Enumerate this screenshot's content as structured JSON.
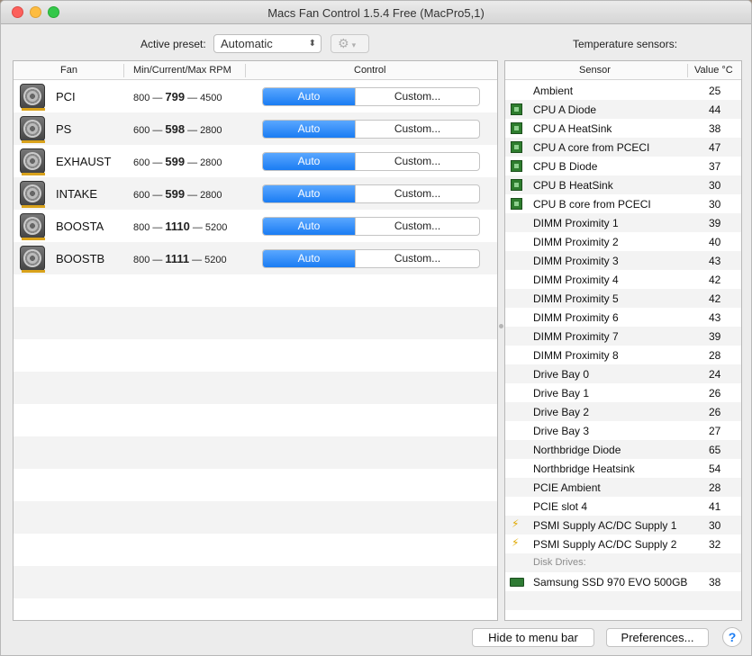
{
  "window": {
    "title": "Macs Fan Control 1.5.4 Free (MacPro5,1)"
  },
  "toolbar": {
    "active_preset_label": "Active preset:",
    "preset_value": "Automatic",
    "temperature_sensors_label": "Temperature sensors:"
  },
  "fan_table": {
    "headers": {
      "fan": "Fan",
      "rpm": "Min/Current/Max RPM",
      "control": "Control"
    },
    "rows": [
      {
        "name": "PCI",
        "min": "800",
        "current": "799",
        "max": "4500",
        "auto": "Auto",
        "custom": "Custom..."
      },
      {
        "name": "PS",
        "min": "600",
        "current": "598",
        "max": "2800",
        "auto": "Auto",
        "custom": "Custom..."
      },
      {
        "name": "EXHAUST",
        "min": "600",
        "current": "599",
        "max": "2800",
        "auto": "Auto",
        "custom": "Custom..."
      },
      {
        "name": "INTAKE",
        "min": "600",
        "current": "599",
        "max": "2800",
        "auto": "Auto",
        "custom": "Custom..."
      },
      {
        "name": "BOOSTA",
        "min": "800",
        "current": "1110",
        "max": "5200",
        "auto": "Auto",
        "custom": "Custom..."
      },
      {
        "name": "BOOSTB",
        "min": "800",
        "current": "1111",
        "max": "5200",
        "auto": "Auto",
        "custom": "Custom..."
      }
    ]
  },
  "sensor_table": {
    "headers": {
      "sensor": "Sensor",
      "value": "Value °C"
    },
    "rows": [
      {
        "name": "Ambient",
        "value": "25",
        "icon": "none"
      },
      {
        "name": "CPU A Diode",
        "value": "44",
        "icon": "chip"
      },
      {
        "name": "CPU A HeatSink",
        "value": "38",
        "icon": "chip"
      },
      {
        "name": "CPU A core from PCECI",
        "value": "47",
        "icon": "chip"
      },
      {
        "name": "CPU B Diode",
        "value": "37",
        "icon": "chip"
      },
      {
        "name": "CPU B HeatSink",
        "value": "30",
        "icon": "chip"
      },
      {
        "name": "CPU B core from PCECI",
        "value": "30",
        "icon": "chip"
      },
      {
        "name": "DIMM Proximity 1",
        "value": "39",
        "icon": "none"
      },
      {
        "name": "DIMM Proximity 2",
        "value": "40",
        "icon": "none"
      },
      {
        "name": "DIMM Proximity 3",
        "value": "43",
        "icon": "none"
      },
      {
        "name": "DIMM Proximity 4",
        "value": "42",
        "icon": "none"
      },
      {
        "name": "DIMM Proximity 5",
        "value": "42",
        "icon": "none"
      },
      {
        "name": "DIMM Proximity 6",
        "value": "43",
        "icon": "none"
      },
      {
        "name": "DIMM Proximity 7",
        "value": "39",
        "icon": "none"
      },
      {
        "name": "DIMM Proximity 8",
        "value": "28",
        "icon": "none"
      },
      {
        "name": "Drive Bay 0",
        "value": "24",
        "icon": "none"
      },
      {
        "name": "Drive Bay 1",
        "value": "26",
        "icon": "none"
      },
      {
        "name": "Drive Bay 2",
        "value": "26",
        "icon": "none"
      },
      {
        "name": "Drive Bay 3",
        "value": "27",
        "icon": "none"
      },
      {
        "name": "Northbridge Diode",
        "value": "65",
        "icon": "none"
      },
      {
        "name": "Northbridge Heatsink",
        "value": "54",
        "icon": "none"
      },
      {
        "name": "PCIE Ambient",
        "value": "28",
        "icon": "none"
      },
      {
        "name": "PCIE slot 4",
        "value": "41",
        "icon": "none"
      },
      {
        "name": "PSMI Supply AC/DC Supply 1",
        "value": "30",
        "icon": "bolt"
      },
      {
        "name": "PSMI Supply AC/DC Supply 2",
        "value": "32",
        "icon": "bolt"
      },
      {
        "name": "Disk Drives:",
        "value": "",
        "icon": "section"
      },
      {
        "name": "Samsung SSD 970 EVO 500GB",
        "value": "38",
        "icon": "ssd"
      }
    ]
  },
  "footer": {
    "hide_menu_bar": "Hide to menu bar",
    "preferences": "Preferences...",
    "help": "?"
  }
}
